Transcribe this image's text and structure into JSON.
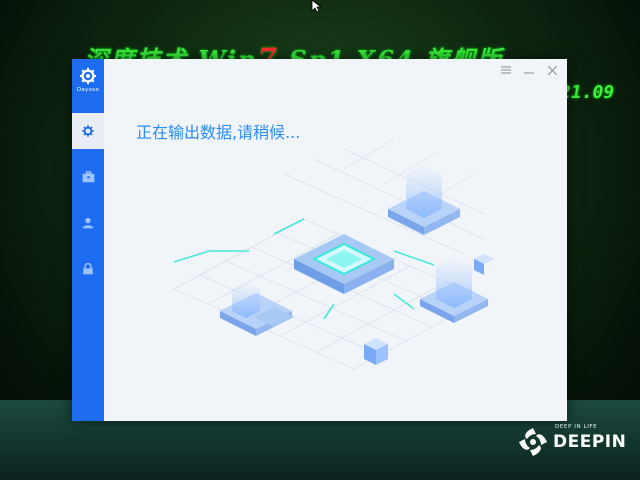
{
  "desktop": {
    "title_prefix": "深度技术 Win",
    "title_seven": "7",
    "title_suffix": " Sp1 X64 旗舰版",
    "version": "21.09"
  },
  "window": {
    "brand_name": "Dayoso",
    "status_text": "正在输出数据,请稍候...",
    "controls": [
      "menu-icon",
      "minimize-icon",
      "close-icon"
    ],
    "nav_icons": [
      "gear-icon",
      "toolbox-icon",
      "user-icon",
      "lock-icon"
    ],
    "accent_color": "#1e6df0",
    "text_color": "#2a8cf5"
  },
  "watermark": {
    "tagline": "DEEP IN LIFE",
    "name": "DEEPIN"
  }
}
